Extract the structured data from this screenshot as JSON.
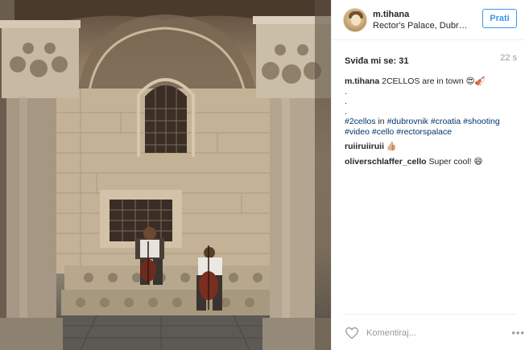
{
  "post": {
    "photo": {
      "alt_icon": "photo-of-palace-arcade-with-two-cellists"
    },
    "header": {
      "username": "m.tihana",
      "location": "Rector's Palace, Dubro...",
      "follow_label": "Prati"
    },
    "meta": {
      "likes": "Sviđa mi se: 31",
      "time": "22 s"
    },
    "caption": {
      "username": "m.tihana",
      "text": "2CELLOS are in town 😍🎻",
      "dots": [
        ".",
        ".",
        "."
      ],
      "hashtags_line1": [
        "#2cellos",
        "in",
        "#dubrovnik",
        "#croatia",
        "#shooting"
      ],
      "hashtags_line2": [
        "#video",
        "#cello",
        "#rectorspalace"
      ]
    },
    "comments": [
      {
        "username": "",
        "text": "ruiiruiiruii 👍🏼"
      },
      {
        "username": "oliverschlaffer_cello",
        "text": "Super cool! 😄"
      }
    ],
    "footer": {
      "add_comment_placeholder": "Komentiraj...",
      "more_label": "•••"
    }
  }
}
